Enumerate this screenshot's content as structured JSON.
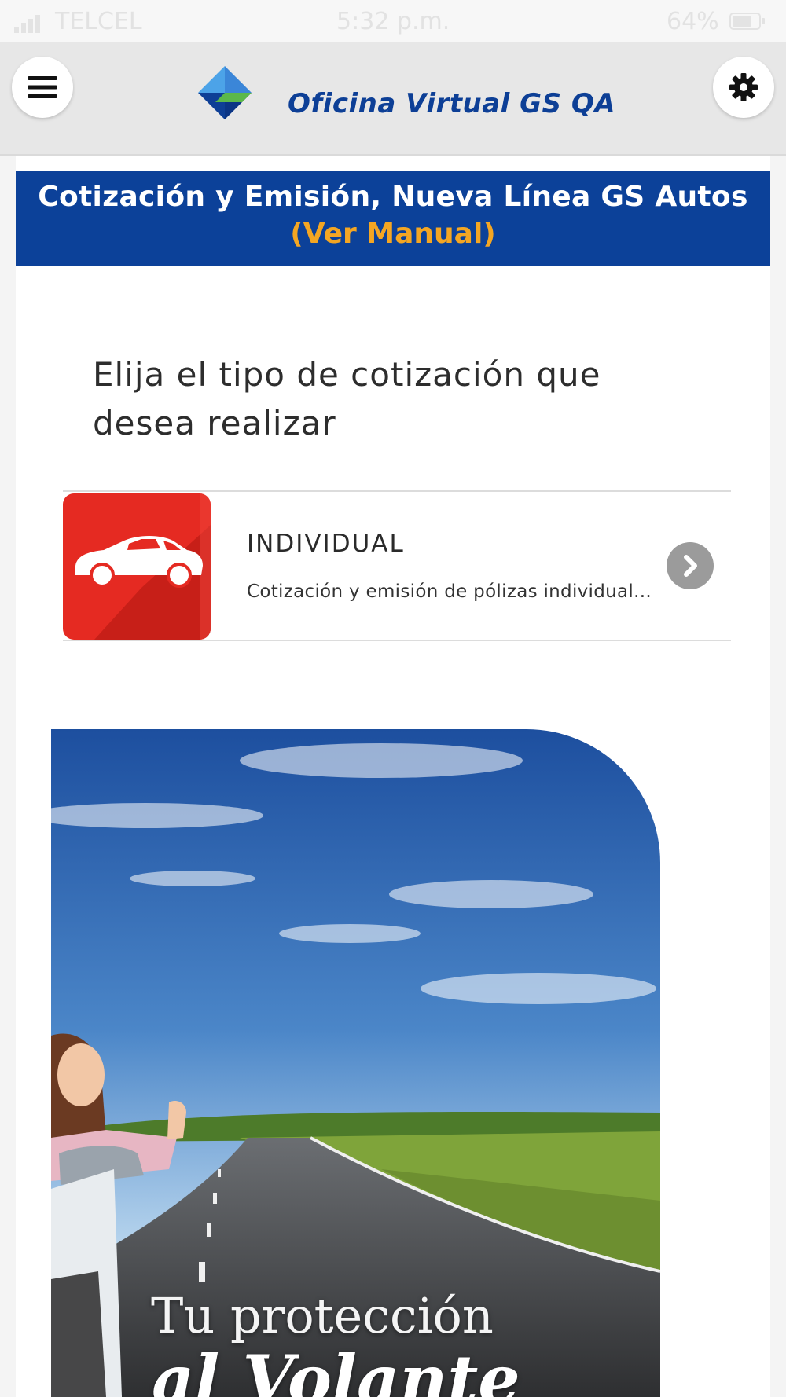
{
  "status_bar": {
    "carrier": "TELCEL",
    "time": "5:32 p.m.",
    "battery": "64%"
  },
  "header": {
    "title": "Oficina Virtual GS QA",
    "menu_icon": "hamburger-menu-icon",
    "settings_icon": "gear-icon",
    "logo": "diamond-logo"
  },
  "banner": {
    "title": "Cotización y Emisión, Nueva Línea GS Autos",
    "manual_link": "(Ver Manual)"
  },
  "prompt": "Elija el tipo de cotización que desea realizar",
  "options": [
    {
      "title": "INDIVIDUAL",
      "description": "Cotización y emisión de pólizas individual...",
      "icon": "car-icon",
      "arrow_icon": "chevron-right-icon"
    }
  ],
  "promo": {
    "line1": "Tu protección",
    "line2": "al Volante"
  },
  "colors": {
    "brand_blue": "#0c4199",
    "accent_orange": "#f4a623",
    "option_red": "#e52a22"
  }
}
